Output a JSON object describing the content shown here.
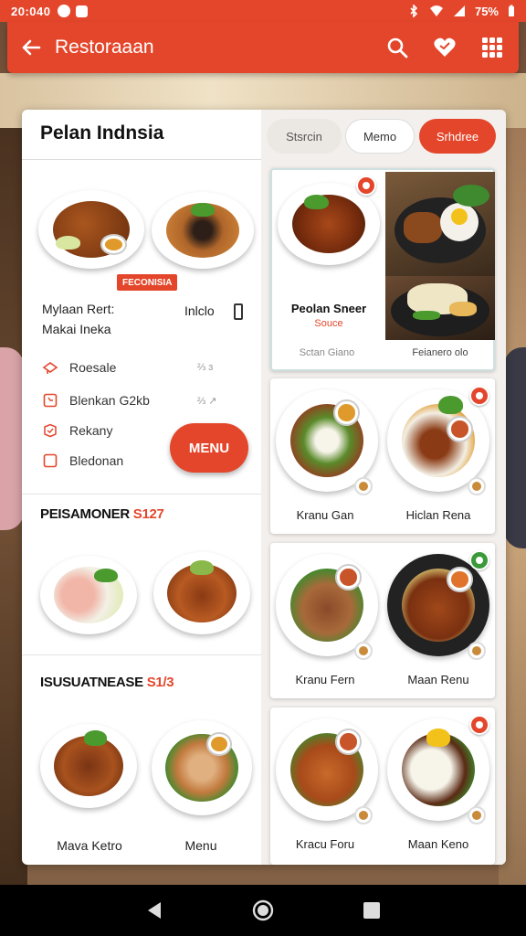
{
  "status_bar": {
    "time": "20:040",
    "battery": "75%"
  },
  "app_bar": {
    "title": "Restoraaan"
  },
  "left_panel": {
    "title": "Pelan Indnsia",
    "badge": "FECONISIA",
    "info_line1": "Mylaan Rert:",
    "info_line2": "Makai Ineka",
    "info_right": "Inlclo",
    "options": [
      {
        "label": "Roesale",
        "mark": "⅔  ɜ"
      },
      {
        "label": "Blenkan G2kb",
        "mark": "⅔  ↗"
      },
      {
        "label": "Rekany",
        "mark": ""
      },
      {
        "label": "Bledonan",
        "mark": ""
      }
    ],
    "menu_button": "MENU",
    "section1": {
      "title": "PEISAMONER",
      "price": "S127"
    },
    "section2": {
      "title": "ISUSUATNEASE",
      "price": "S1/3"
    },
    "captions": [
      "Mava Ketro",
      "Menu"
    ]
  },
  "right_panel": {
    "tabs": [
      "Stsrcin",
      "Memo",
      "Srhdree"
    ],
    "featured": {
      "title": "Peolan Sneer",
      "subtitle": "Souce",
      "caption_left": "Sctan Giano",
      "caption_right": "Feianero olo"
    },
    "rows": [
      {
        "left": "Kranu Gan",
        "right": "Hiclan Rena"
      },
      {
        "left": "Kranu Fern",
        "right": "Maan Renu"
      },
      {
        "left": "Kracu Foru",
        "right": "Maan Keno"
      }
    ]
  },
  "colors": {
    "accent": "#e4462b"
  },
  "icons": [
    "back-arrow-icon",
    "search-icon",
    "heart-icon",
    "grid-icon",
    "home-icon"
  ]
}
